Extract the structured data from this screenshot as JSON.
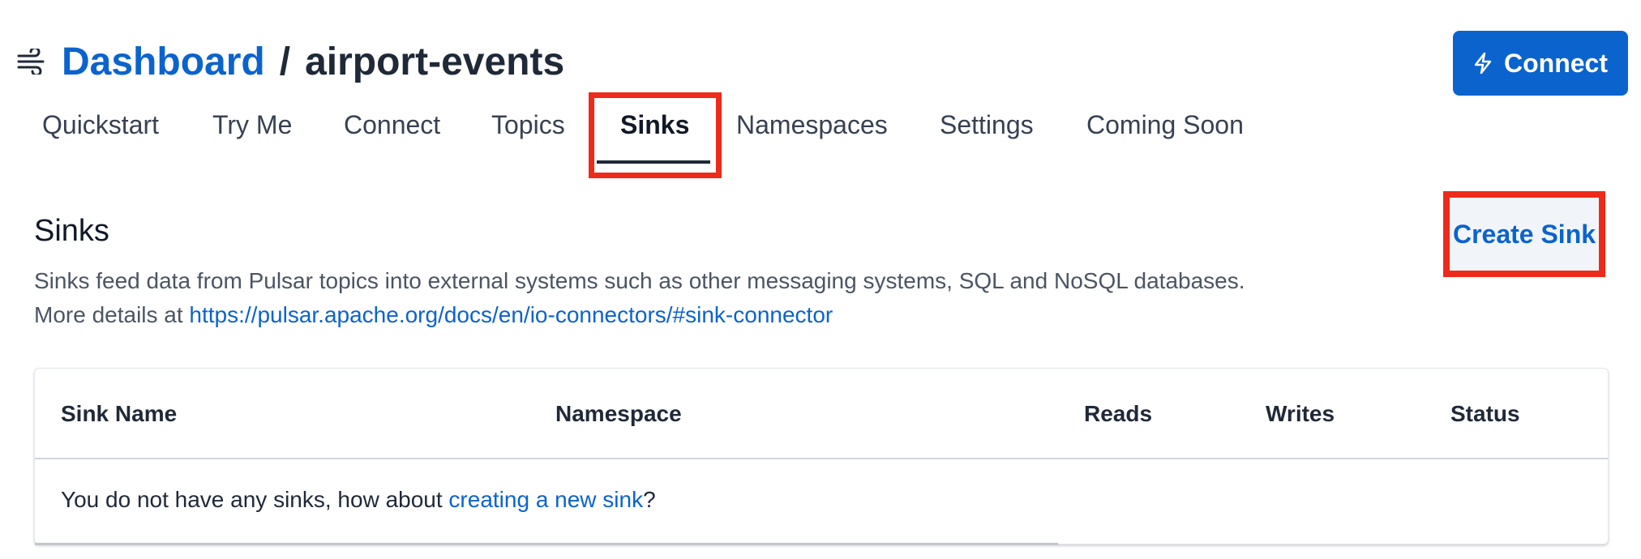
{
  "header": {
    "logo_icon": "wind-icon",
    "breadcrumb_root": "Dashboard",
    "separator": "/",
    "current": "airport-events"
  },
  "connect_button": {
    "label": "Connect",
    "icon": "bolt-icon"
  },
  "tabs": [
    {
      "label": "Quickstart"
    },
    {
      "label": "Try Me"
    },
    {
      "label": "Connect"
    },
    {
      "label": "Topics"
    },
    {
      "label": "Sinks",
      "active": true
    },
    {
      "label": "Namespaces"
    },
    {
      "label": "Settings"
    },
    {
      "label": "Coming Soon"
    }
  ],
  "section": {
    "title": "Sinks",
    "description": "Sinks feed data from Pulsar topics into external systems such as other messaging systems, SQL and NoSQL databases.",
    "details_prefix": "More details at ",
    "details_link": "https://pulsar.apache.org/docs/en/io-connectors/#sink-connector"
  },
  "create_sink": {
    "label": "Create Sink"
  },
  "table": {
    "columns": [
      "Sink Name",
      "Namespace",
      "Reads",
      "Writes",
      "Status"
    ],
    "empty_prefix": "You do not have any sinks, how about ",
    "empty_link": "creating a new sink",
    "empty_suffix": "?"
  },
  "colors": {
    "accent": "#0b63ce",
    "highlight": "#ee2a1b"
  }
}
